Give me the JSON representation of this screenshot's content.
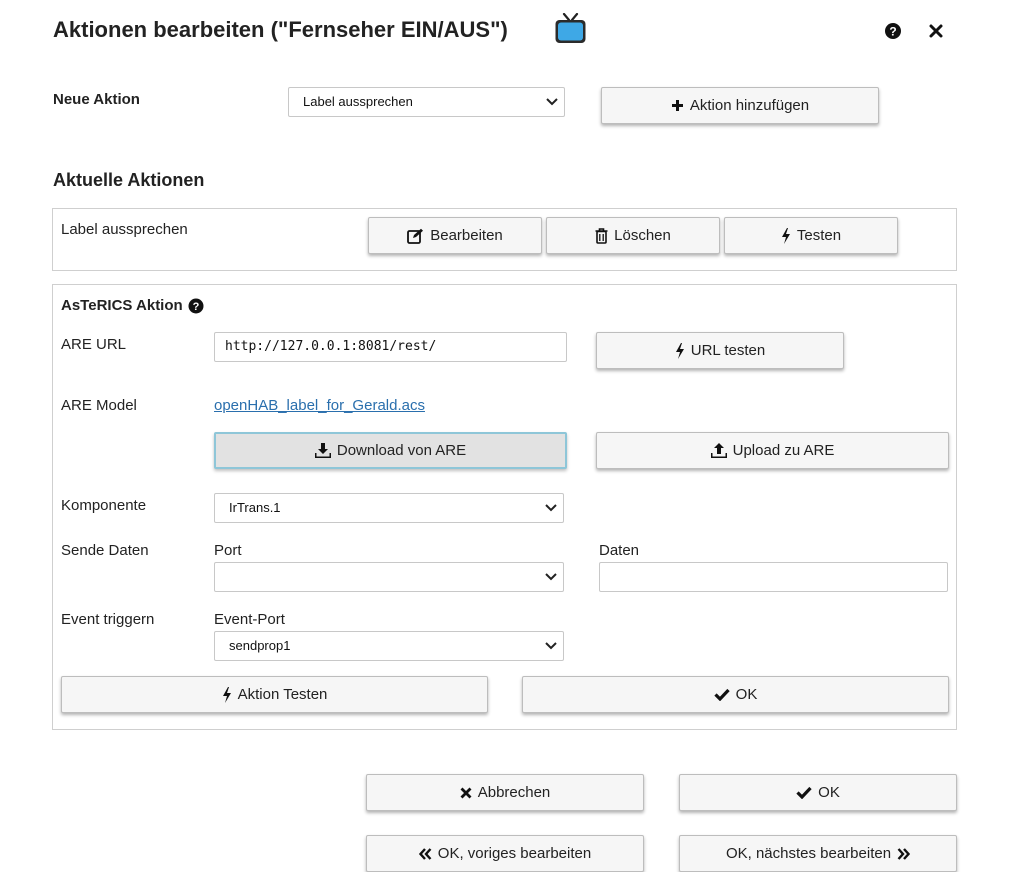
{
  "dialog": {
    "title": "Aktionen bearbeiten (\"Fernseher EIN/AUS\")",
    "title_icon": "tv-icon",
    "help_icon": "question-circle-icon",
    "close_icon": "close-icon"
  },
  "new_action": {
    "label": "Neue Aktion",
    "select_value": "Label aussprechen",
    "add_button": "Aktion hinzufügen"
  },
  "current_actions": {
    "heading": "Aktuelle Aktionen",
    "items": [
      {
        "label": "Label aussprechen",
        "edit": "Bearbeiten",
        "delete": "Löschen",
        "test": "Testen"
      }
    ]
  },
  "asterics": {
    "heading": "AsTeRICS Aktion",
    "are_url_label": "ARE URL",
    "are_url_value": "http://127.0.0.1:8081/rest/",
    "url_test_button": "URL testen",
    "are_model_label": "ARE Model",
    "are_model_link": "openHAB_label_for_Gerald.acs",
    "download_button": "Download von ARE",
    "upload_button": "Upload zu ARE",
    "component_label": "Komponente",
    "component_value": "IrTrans.1",
    "send_data_label": "Sende Daten",
    "port_label": "Port",
    "port_value": "",
    "data_label": "Daten",
    "data_value": "",
    "event_label": "Event triggern",
    "event_port_label": "Event-Port",
    "event_port_value": "sendprop1",
    "test_action_button": "Aktion Testen",
    "ok_button": "OK"
  },
  "footer": {
    "cancel": "Abbrechen",
    "ok": "OK",
    "ok_prev": "OK, voriges bearbeiten",
    "ok_next": "OK, nächstes bearbeiten"
  },
  "colors": {
    "link": "#2a6fad",
    "tv_screen": "#3ea8e6",
    "pressed_border": "#8ec6d8"
  }
}
